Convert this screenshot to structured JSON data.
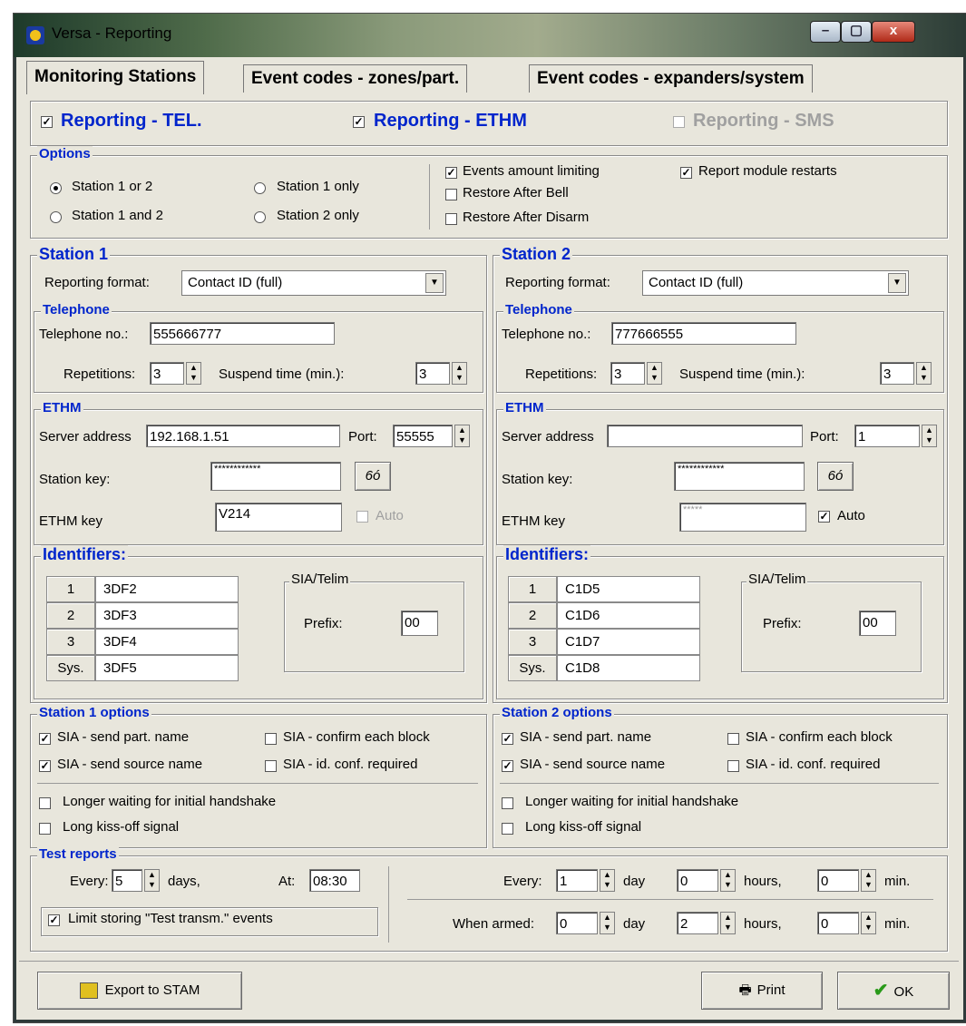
{
  "window": {
    "title": "Versa - Reporting",
    "minimize": "–",
    "maximize": "▢",
    "close": "x"
  },
  "tabs": [
    "Monitoring Stations",
    "Event codes - zones/part.",
    "Event codes - expanders/system"
  ],
  "reporting": {
    "tel": "Reporting - TEL.",
    "ethm": "Reporting - ETHM",
    "sms": "Reporting - SMS"
  },
  "options": {
    "title": "Options",
    "radio": [
      "Station 1 or 2",
      "Station 1 only",
      "Station 1 and 2",
      "Station 2 only"
    ],
    "events_limit": "Events amount limiting",
    "restore_bell": "Restore After Bell",
    "restore_disarm": "Restore After Disarm",
    "report_restarts": "Report module restarts"
  },
  "labels": {
    "reporting_format": "Reporting format:",
    "telephone": "Telephone",
    "telephone_no": "Telephone no.:",
    "repetitions": "Repetitions:",
    "suspend": "Suspend time (min.):",
    "ethm": "ETHM",
    "server_address": "Server address",
    "port": "Port:",
    "station_key": "Station key:",
    "ethm_key": "ETHM key",
    "auto": "Auto",
    "identifiers": "Identifiers:",
    "sia_telim": "SIA/Telim",
    "prefix": "Prefix:",
    "glasses": "6ó",
    "sia_part": "SIA - send part. name",
    "sia_confirm": "SIA - confirm each block",
    "sia_source": "SIA - send source name",
    "sia_idconf": "SIA - id. conf. required",
    "longer_wait": "Longer waiting for initial handshake",
    "long_kiss": "Long kiss-off signal"
  },
  "station1": {
    "title": "Station 1",
    "format": "Contact ID (full)",
    "phone": "555666777",
    "repetitions": "3",
    "suspend": "3",
    "server": "192.168.1.51",
    "port": "55555",
    "station_key": "************",
    "ethm_key": "V214",
    "ids": [
      [
        "1",
        "3DF2"
      ],
      [
        "2",
        "3DF3"
      ],
      [
        "3",
        "3DF4"
      ],
      [
        "Sys.",
        "3DF5"
      ]
    ],
    "prefix": "00",
    "options_title": "Station 1 options"
  },
  "station2": {
    "title": "Station 2",
    "format": "Contact ID (full)",
    "phone": "777666555",
    "repetitions": "3",
    "suspend": "3",
    "server": "",
    "port": "1",
    "station_key": "************",
    "ethm_key": "*****",
    "ids": [
      [
        "1",
        "C1D5"
      ],
      [
        "2",
        "C1D6"
      ],
      [
        "3",
        "C1D7"
      ],
      [
        "Sys.",
        "C1D8"
      ]
    ],
    "prefix": "00",
    "options_title": "Station 2 options"
  },
  "test": {
    "title": "Test reports",
    "every": "Every:",
    "every_days": "5",
    "days": "days,",
    "at": "At:",
    "at_time": "08:30",
    "limit": "Limit storing \"Test transm.\" events",
    "every2": "Every:",
    "e_day": "1",
    "day": "day",
    "e_hours": "0",
    "hours": "hours,",
    "e_min": "0",
    "min": "min.",
    "when_armed": "When armed:",
    "w_day": "0",
    "w_hours": "2",
    "w_min": "0"
  },
  "buttons": {
    "export": "Export to STAM",
    "print": "Print",
    "ok": "OK"
  },
  "colors": {
    "accent": "#0025cc",
    "face": "#e8e6dc"
  }
}
